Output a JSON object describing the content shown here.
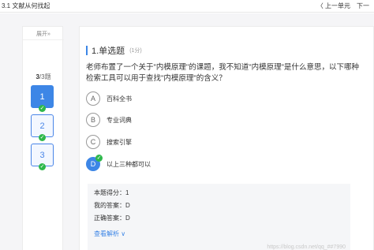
{
  "header": {
    "title": "3.1 文献从何找起",
    "prev_label": "〈 上一单元",
    "next_label": "下一"
  },
  "sidebar": {
    "expand_label": "展开»",
    "count_current": "3",
    "count_total": "/3题",
    "questions": [
      {
        "num": "1",
        "done": true,
        "active": true
      },
      {
        "num": "2",
        "done": true,
        "active": false
      },
      {
        "num": "3",
        "done": true,
        "active": false
      }
    ]
  },
  "main": {
    "section_title": "1.单选题",
    "section_points": "(1分)",
    "question": "老师布置了一个关于\"内模原理\"的课题，我不知道\"内模原理\"是什么意思，以下哪种检索工具可以用于查找\"内模原理\"的含义？",
    "options": [
      {
        "letter": "A",
        "text": "百科全书"
      },
      {
        "letter": "B",
        "text": "专业词典"
      },
      {
        "letter": "C",
        "text": "搜索引擎"
      },
      {
        "letter": "D",
        "text": "以上三种都可以"
      }
    ],
    "selected": "D",
    "result": {
      "score": "本题得分：1",
      "my_answer": "我的答案：D",
      "correct_answer": "正确答案：D",
      "view_analysis": "查看解析 ∨"
    }
  },
  "watermark": "https://blog.csdn.net/qq_##7990",
  "icons": {
    "check": "✓"
  },
  "colors": {
    "accent": "#3d86e6",
    "success": "#2eb84b"
  }
}
